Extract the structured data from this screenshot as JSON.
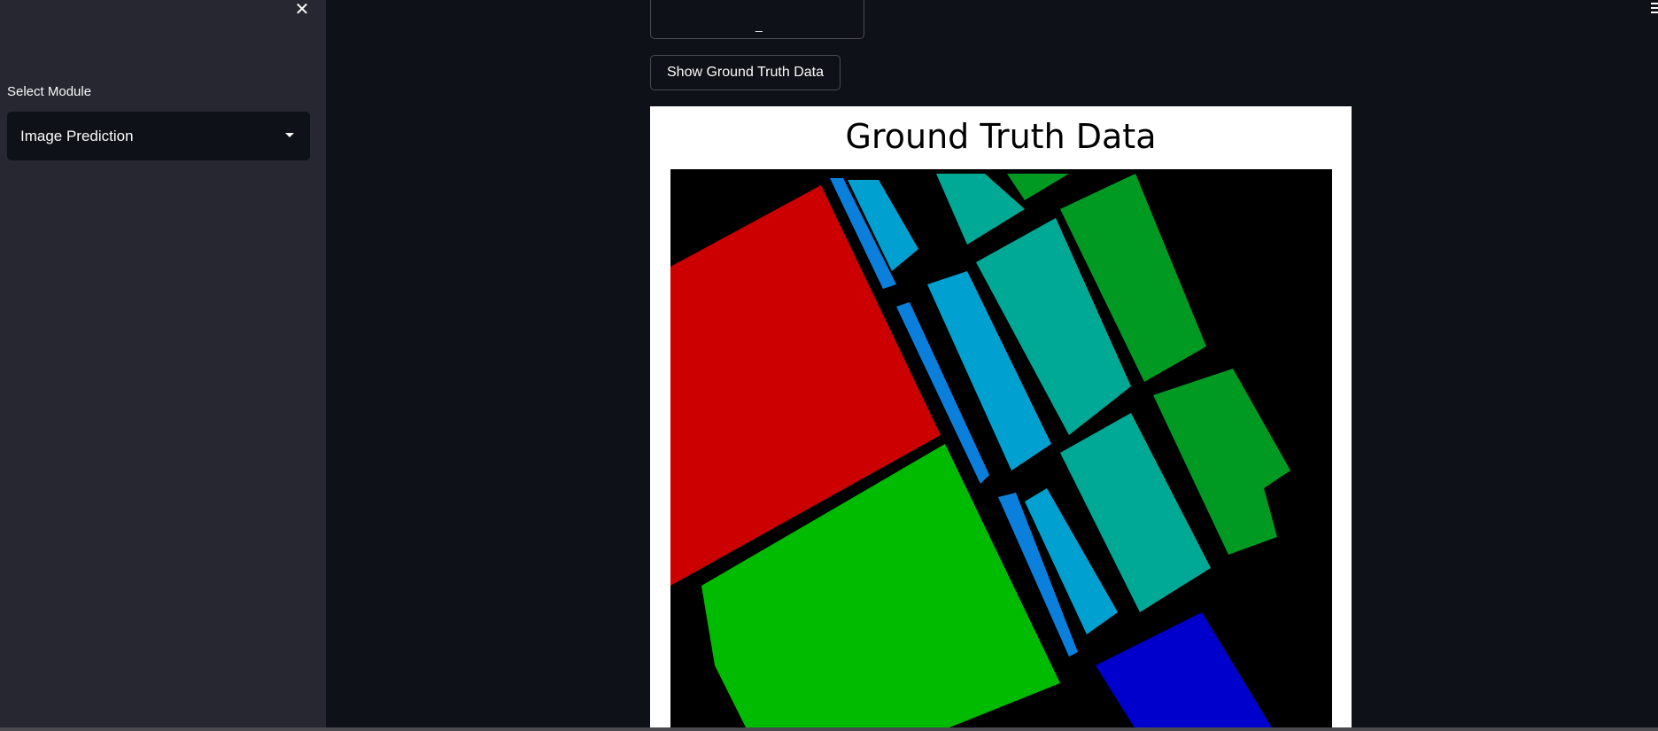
{
  "sidebar": {
    "close_icon": "close-icon",
    "select_label": "Select Module",
    "select_value": "Image Prediction"
  },
  "main": {
    "menu_icon": "hamburger-menu-icon",
    "top_button_partial": "_",
    "ground_truth_button": "Show Ground Truth Data",
    "figure_title": "Ground Truth Data"
  },
  "colors": {
    "app_bg": "#0e1117",
    "sidebar_bg": "#262730",
    "text": "#fafafa",
    "class_red": "#cc0000",
    "class_green": "#00bb00",
    "class_blue": "#0000cc",
    "class_light_blue": "#0a7fdc",
    "class_sky": "#00a0d0",
    "class_teal": "#00a896",
    "class_dark_green": "#009922"
  }
}
